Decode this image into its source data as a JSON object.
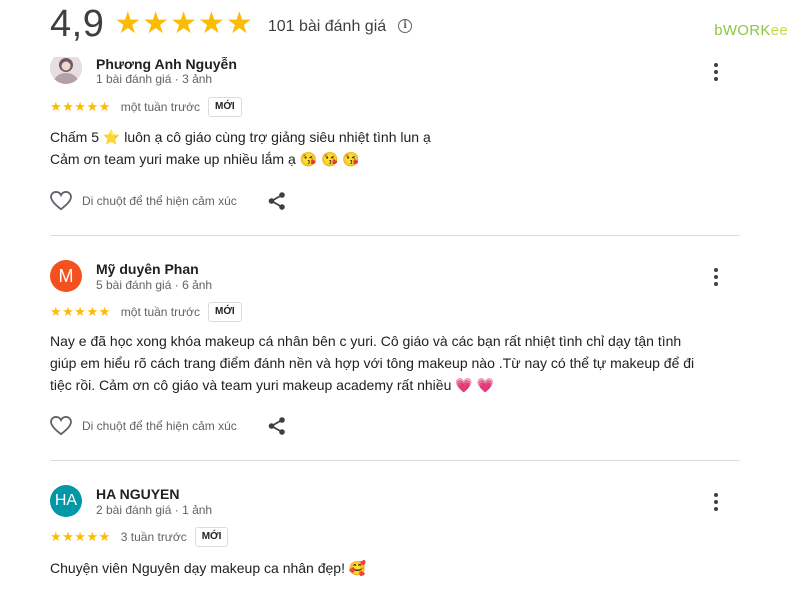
{
  "header": {
    "rating": "4,9",
    "stars": "★★★★★",
    "review_count": "101 bài đánh giá",
    "info_symbol": "i"
  },
  "brand": {
    "part1": "bWORK",
    "part2": "ee"
  },
  "colors": {
    "star": "#fbbc04",
    "avatar_m": "#f4511e",
    "avatar_ha": "#0097a7",
    "brand": "#8cc63f"
  },
  "reviews": [
    {
      "name": "Phương Anh Nguyễn",
      "meta": "1 bài đánh giá · 3 ảnh",
      "stars": "★★★★★",
      "time": "một tuần trước",
      "badge": "MỚI",
      "lines": [
        "Chấm 5 ⭐ luôn ạ cô giáo cùng trợ giảng siêu nhiệt tình lun ạ",
        "Cảm ơn team yuri make up nhiều lắm ạ 😘 😘 😘"
      ],
      "react_label": "Di chuột để thể hiện cảm xúc"
    },
    {
      "initial": "M",
      "name": "Mỹ duyên Phan",
      "meta": "5 bài đánh giá · 6 ảnh",
      "stars": "★★★★★",
      "time": "một tuần trước",
      "badge": "MỚI",
      "lines": [
        "Nay e đã học xong khóa makeup cá nhân bên c yuri. Cô giáo và các bạn rất nhiệt tình chỉ dạy tận tình",
        "giúp em hiểu rõ cách trang điểm đánh nền và hợp với tông makeup nào .Từ nay có thể tự makeup để đi",
        "tiệc rồi. Cảm ơn cô giáo và team yuri makeup academy rất nhiều 💗 💗"
      ],
      "react_label": "Di chuột để thể hiện cảm xúc"
    },
    {
      "initial": "HA",
      "name": "HA NGUYEN",
      "meta": "2 bài đánh giá · 1 ảnh",
      "stars": "★★★★★",
      "time": "3 tuần trước",
      "badge": "MỚI",
      "lines": [
        "Chuyện viên Nguyên dạy makeup ca nhân đẹp! 🥰"
      ]
    }
  ]
}
